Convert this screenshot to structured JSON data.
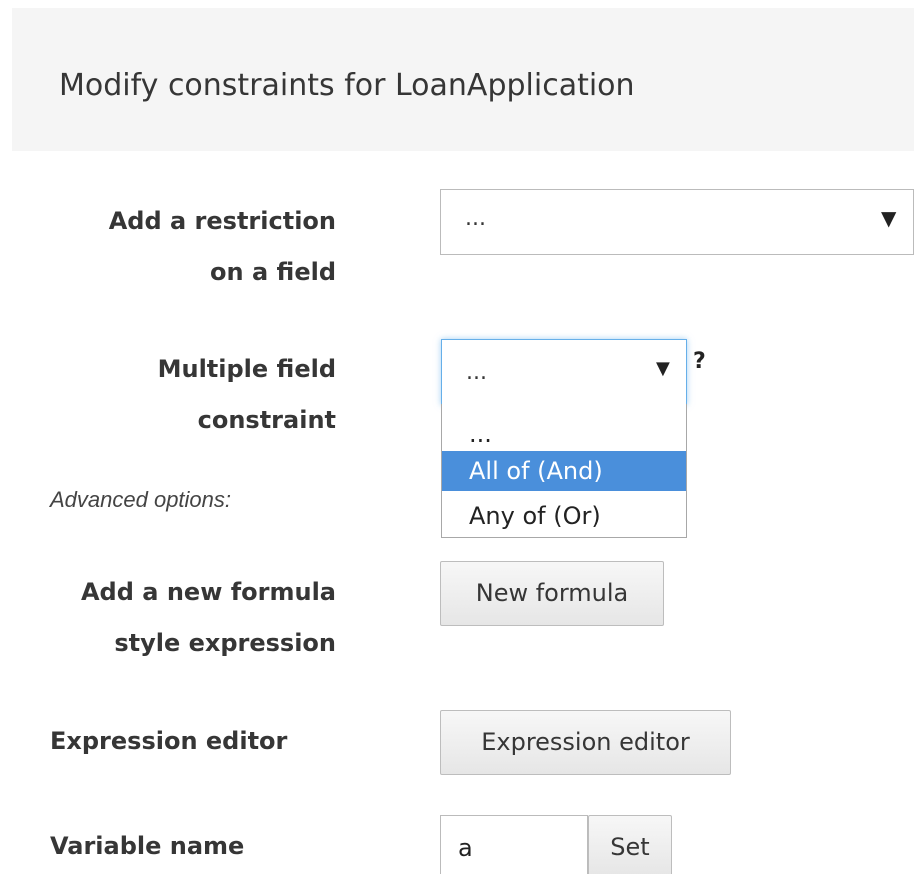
{
  "header": {
    "title": "Modify constraints for LoanApplication"
  },
  "restriction": {
    "label_line1": "Add a restriction",
    "label_line2": "on a field",
    "selected": "..."
  },
  "multiple_field": {
    "label_line1": "Multiple field",
    "label_line2": "constraint",
    "selected": "...",
    "help": "?",
    "options": [
      {
        "label": "...",
        "selected": false
      },
      {
        "label": "All of (And)",
        "selected": true
      },
      {
        "label": "Any of (Or)",
        "selected": false
      }
    ]
  },
  "advanced": {
    "label": "Advanced options:"
  },
  "formula": {
    "label_line1": "Add a new formula",
    "label_line2": "style expression",
    "button": "New formula"
  },
  "expression_editor": {
    "label": "Expression editor",
    "button": "Expression editor"
  },
  "variable": {
    "label": "Variable name",
    "value": "a",
    "button": "Set"
  },
  "colors": {
    "selected_option_bg": "#4a8fdb",
    "focus_border": "#66afe9",
    "header_bg": "#f5f5f5"
  }
}
